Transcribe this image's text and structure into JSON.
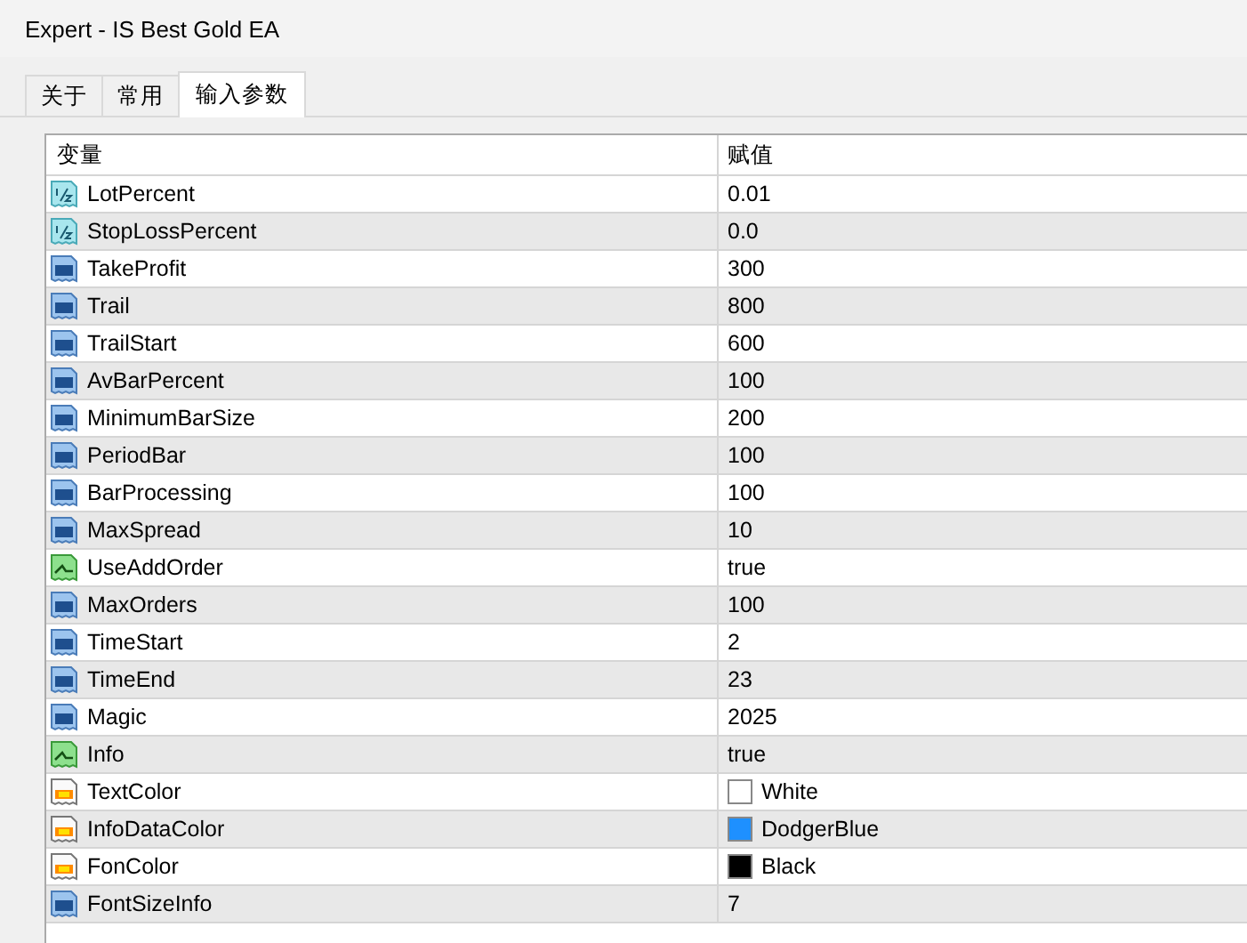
{
  "window": {
    "title": "Expert - IS Best Gold EA"
  },
  "tabs": [
    {
      "label": "关于",
      "selected": false
    },
    {
      "label": "常用",
      "selected": false
    },
    {
      "label": "输入参数",
      "selected": true
    }
  ],
  "table": {
    "columns": [
      "变量",
      "赋值"
    ],
    "rows": [
      {
        "kind": "double",
        "name": "LotPercent",
        "value": "0.01"
      },
      {
        "kind": "double",
        "name": "StopLossPercent",
        "value": "0.0"
      },
      {
        "kind": "int",
        "name": "TakeProfit",
        "value": "300"
      },
      {
        "kind": "int",
        "name": "Trail",
        "value": "800"
      },
      {
        "kind": "int",
        "name": "TrailStart",
        "value": "600"
      },
      {
        "kind": "int",
        "name": "AvBarPercent",
        "value": "100"
      },
      {
        "kind": "int",
        "name": "MinimumBarSize",
        "value": "200"
      },
      {
        "kind": "int",
        "name": "PeriodBar",
        "value": "100"
      },
      {
        "kind": "int",
        "name": "BarProcessing",
        "value": "100"
      },
      {
        "kind": "int",
        "name": "MaxSpread",
        "value": "10"
      },
      {
        "kind": "bool",
        "name": "UseAddOrder",
        "value": "true"
      },
      {
        "kind": "int",
        "name": "MaxOrders",
        "value": "100"
      },
      {
        "kind": "int",
        "name": "TimeStart",
        "value": "2"
      },
      {
        "kind": "int",
        "name": "TimeEnd",
        "value": "23"
      },
      {
        "kind": "int",
        "name": "Magic",
        "value": "2025"
      },
      {
        "kind": "bool",
        "name": "Info",
        "value": "true"
      },
      {
        "kind": "color",
        "name": "TextColor",
        "value": "White",
        "color": "#ffffff"
      },
      {
        "kind": "color",
        "name": "InfoDataColor",
        "value": "DodgerBlue",
        "color": "#1e90ff"
      },
      {
        "kind": "color",
        "name": "FonColor",
        "value": "Black",
        "color": "#000000"
      },
      {
        "kind": "int",
        "name": "FontSizeInfo",
        "value": "7"
      }
    ]
  }
}
